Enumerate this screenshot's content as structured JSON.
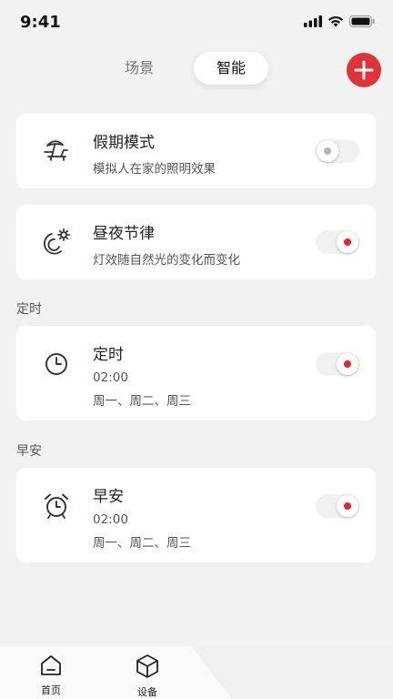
{
  "status": {
    "time": "9:41"
  },
  "tabs": [
    {
      "label": "场景",
      "active": false
    },
    {
      "label": "智能",
      "active": true
    }
  ],
  "add_button": {
    "icon": "plus-icon"
  },
  "cards": [
    {
      "icon": "beach-umbrella-icon",
      "title": "假期模式",
      "subtitle": "模拟人在家的照明效果",
      "enabled": false
    },
    {
      "icon": "day-night-icon",
      "title": "昼夜节律",
      "subtitle": "灯效随自然光的变化而变化",
      "enabled": true
    }
  ],
  "sections": [
    {
      "label": "定时",
      "card": {
        "icon": "clock-icon",
        "title": "定时",
        "time": "02:00",
        "days": "周一、周二、周三",
        "enabled": true
      }
    },
    {
      "label": "早安",
      "card": {
        "icon": "alarm-clock-icon",
        "title": "早安",
        "time": "02:00",
        "days": "周一、周二、周三",
        "enabled": true
      }
    }
  ],
  "bottom_nav": [
    {
      "label": "首页",
      "icon": "home-icon"
    },
    {
      "label": "设备",
      "icon": "cube-icon"
    }
  ],
  "colors": {
    "accent": "#e0323a",
    "background": "#f2f2f2",
    "card": "#ffffff"
  }
}
